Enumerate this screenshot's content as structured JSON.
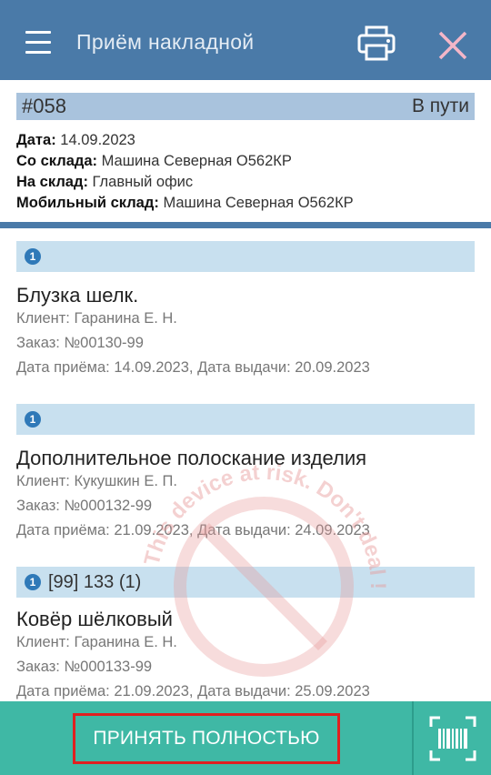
{
  "appbar": {
    "title": "Приём накладной"
  },
  "document": {
    "number": "#058",
    "status": "В пути",
    "fields": [
      {
        "label": "Дата:",
        "value": "14.09.2023"
      },
      {
        "label": "Со склада:",
        "value": "Машина Северная О562КР"
      },
      {
        "label": "На склад:",
        "value": "Главный офис"
      },
      {
        "label": "Мобильный склад:",
        "value": "Машина Северная О562КР"
      }
    ]
  },
  "items": [
    {
      "badge": "1",
      "bar_text": "",
      "name": "Блузка шелк.",
      "client": "Клиент: Гаранина Е. Н.",
      "order": "Заказ: №00130-99",
      "dates": "Дата приёма: 14.09.2023, Дата выдачи: 20.09.2023"
    },
    {
      "badge": "1",
      "bar_text": "",
      "name": "Дополнительное полоскание изделия",
      "client": "Клиент: Кукушкин Е. П.",
      "order": "Заказ: №000132-99",
      "dates": "Дата приёма: 21.09.2023, Дата выдачи: 24.09.2023"
    },
    {
      "badge": "1",
      "bar_text": "[99] 133 (1)",
      "name": "Ковёр шёлковый",
      "client": "Клиент: Гаранина Е. Н.",
      "order": "Заказ: №000133-99",
      "dates": "Дата приёма: 21.09.2023, Дата выдачи: 25.09.2023"
    }
  ],
  "watermark": {
    "text": "This device at risk. Don't deal !"
  },
  "bottombar": {
    "accept_label": "ПРИНЯТЬ ПОЛНОСТЬЮ"
  },
  "colors": {
    "appbar": "#4a7aa8",
    "doc_bar": "#a9c3dd",
    "item_bar": "#c8e0ef",
    "badge": "#2f79b8",
    "bottombar": "#3fb8a5",
    "highlight": "#e02020",
    "close_icon": "#f4b6c8"
  }
}
